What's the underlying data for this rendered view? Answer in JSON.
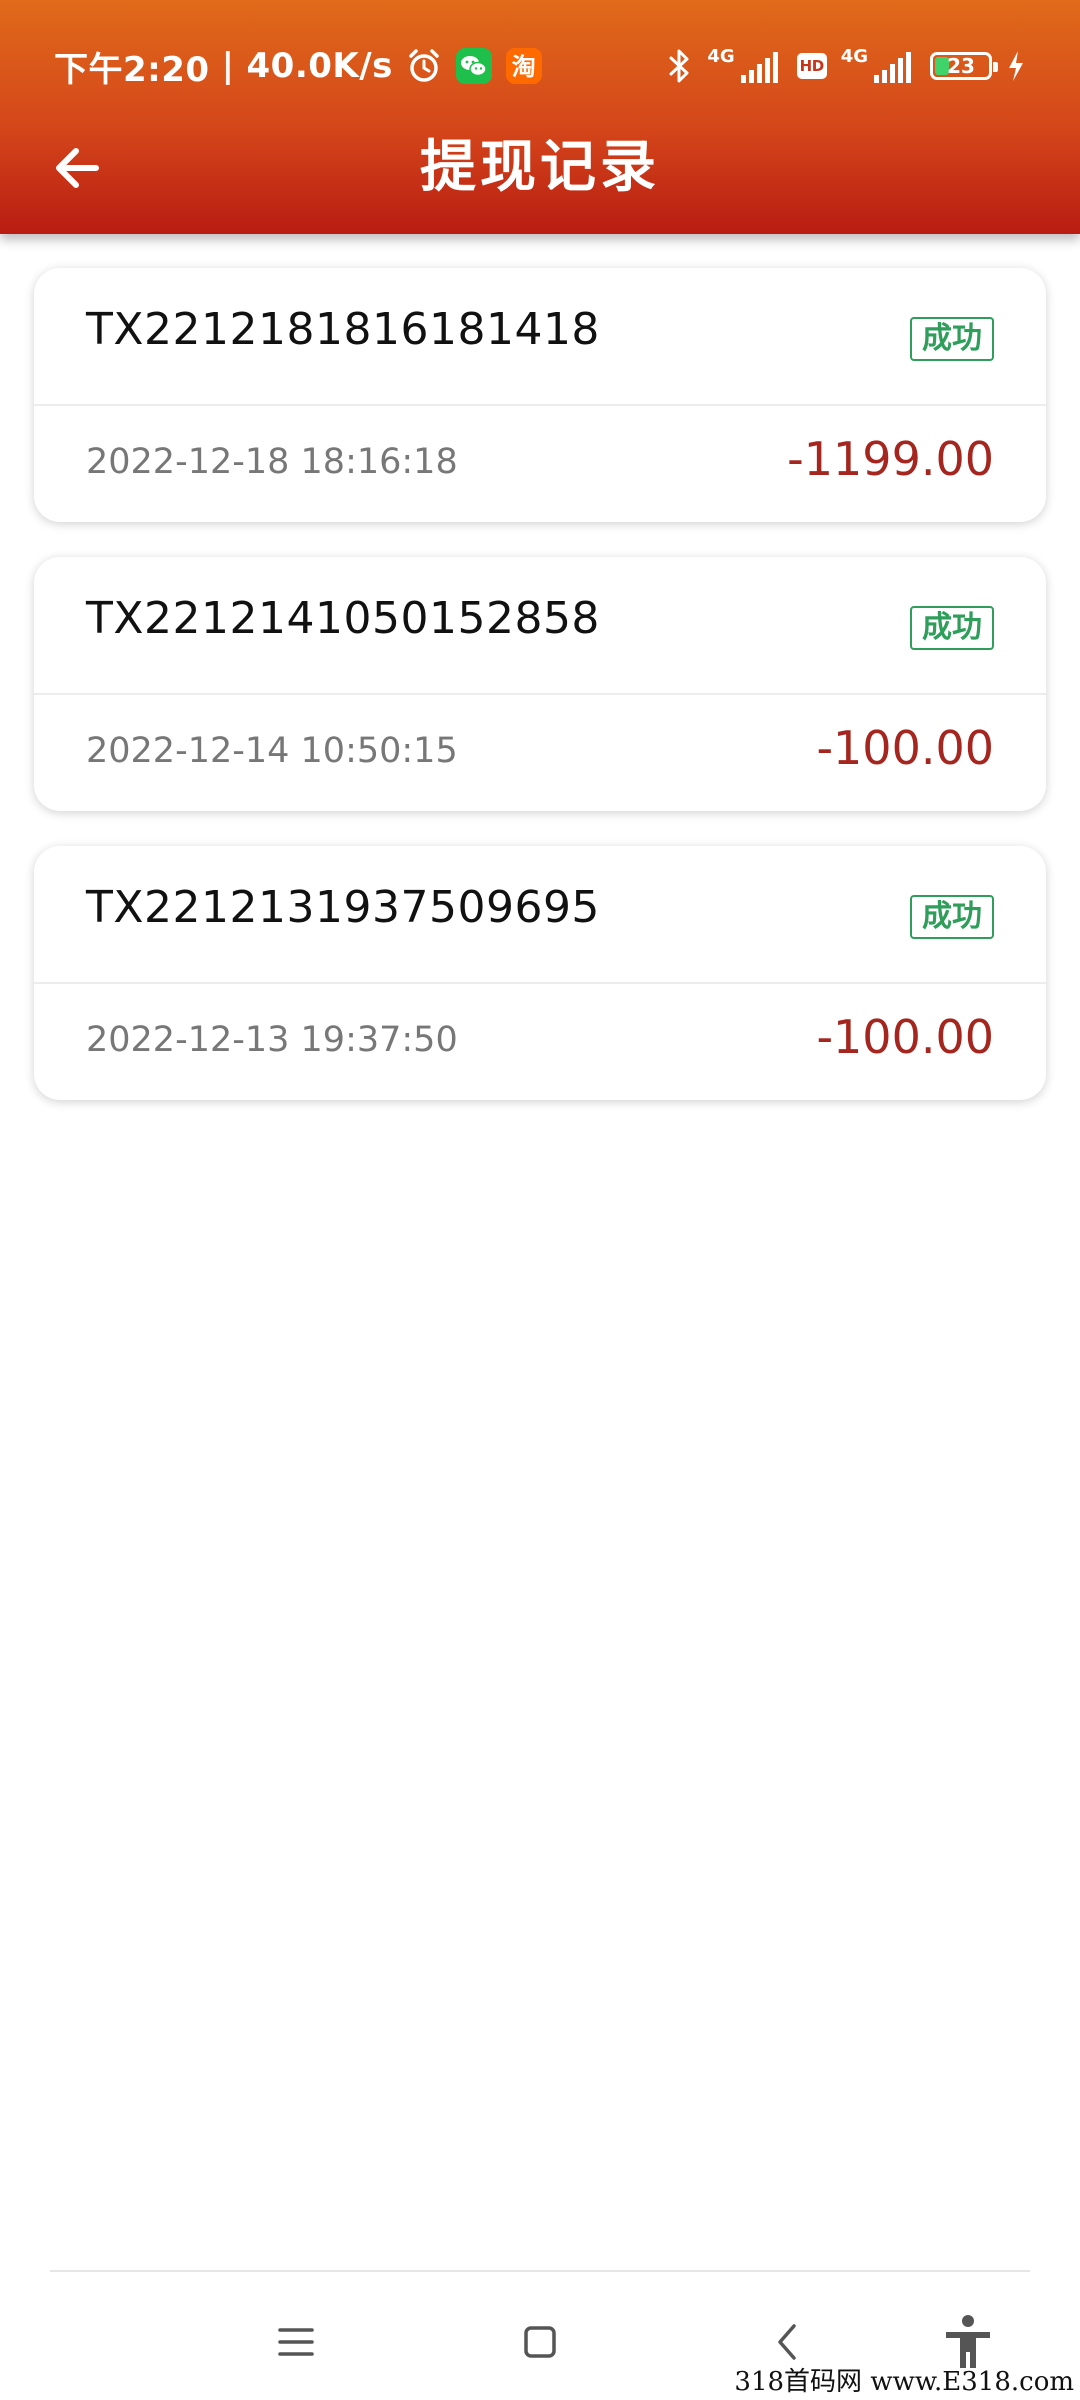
{
  "status_bar": {
    "time": "下午2:20",
    "separator": "|",
    "net_speed": "40.0K/s",
    "wechat_label": "WeChat",
    "taobao_label": "淘",
    "net1": "4G",
    "hd": "HD",
    "net2": "4G",
    "battery": "23"
  },
  "header": {
    "title": "提现记录"
  },
  "records": [
    {
      "order_no": "TX2212181816181418",
      "status": "成功",
      "time": "2022-12-18 18:16:18",
      "amount": "-1199.00"
    },
    {
      "order_no": "TX2212141050152858",
      "status": "成功",
      "time": "2022-12-14 10:50:15",
      "amount": "-100.00"
    },
    {
      "order_no": "TX2212131937509695",
      "status": "成功",
      "time": "2022-12-13 19:37:50",
      "amount": "-100.00"
    }
  ],
  "watermark": "318首码网 www.E318.com",
  "colors": {
    "header_top": "#E06A1A",
    "header_bottom": "#B81C12",
    "success_green": "#2E9E5A",
    "amount_red": "#A5261E"
  },
  "icons": {
    "back": "arrow-left-icon",
    "menu": "menu-icon",
    "home": "home-icon",
    "nav_back": "chevron-left-icon",
    "accessibility": "accessibility-icon"
  }
}
